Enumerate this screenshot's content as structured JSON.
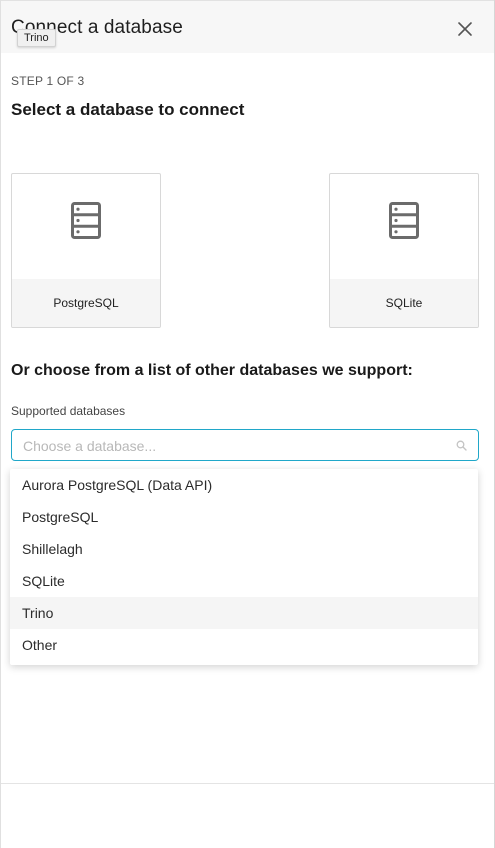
{
  "header": {
    "title": "Connect a database",
    "close_icon": "close-icon"
  },
  "tooltip": "Trino",
  "step": {
    "label": "STEP 1 OF 3",
    "title": "Select a database to connect"
  },
  "preferred_databases": [
    {
      "label": "PostgreSQL",
      "icon": "database-server-icon"
    },
    {
      "label": "SQLite",
      "icon": "database-server-icon"
    }
  ],
  "other": {
    "title": "Or choose from a list of other databases we support:",
    "field_label": "Supported databases",
    "placeholder": "Choose a database...",
    "value": "",
    "options": [
      "Aurora PostgreSQL (Data API)",
      "PostgreSQL",
      "Shillelagh",
      "SQLite",
      "Trino",
      "Other"
    ],
    "highlighted_option": "Trino"
  },
  "colors": {
    "focus_border": "#20a7c9",
    "header_bg": "#f7f7f7",
    "highlight_bg": "#f5f5f5"
  }
}
